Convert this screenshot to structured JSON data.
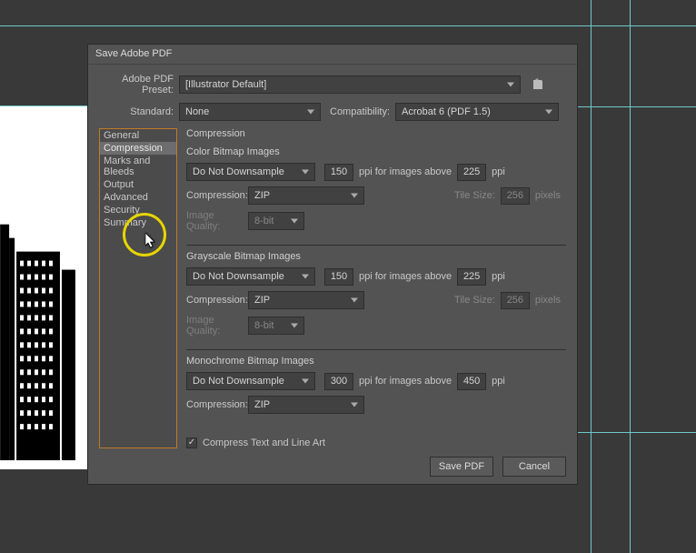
{
  "canvas": {
    "artwork_desc": "building-illustration"
  },
  "dialog": {
    "title": "Save Adobe PDF",
    "preset_label": "Adobe PDF Preset:",
    "preset_value": "[Illustrator Default]",
    "standard_label": "Standard:",
    "standard_value": "None",
    "compat_label": "Compatibility:",
    "compat_value": "Acrobat 6 (PDF 1.5)"
  },
  "sidebar": {
    "items": [
      "General",
      "Compression",
      "Marks and Bleeds",
      "Output",
      "Advanced",
      "Security",
      "Summary"
    ],
    "selected_index": 1
  },
  "panel": {
    "title": "Compression",
    "color": {
      "title": "Color Bitmap Images",
      "downsample": "Do Not Downsample",
      "ppi": "150",
      "above_label": "ppi for images above",
      "above_ppi": "225",
      "ppi_unit": "ppi",
      "compress_label": "Compression:",
      "compress_value": "ZIP",
      "tile_label": "Tile Size:",
      "tile_value": "256",
      "tile_unit": "pixels",
      "quality_label": "Image Quality:",
      "quality_value": "8-bit"
    },
    "gray": {
      "title": "Grayscale Bitmap Images",
      "downsample": "Do Not Downsample",
      "ppi": "150",
      "above_label": "ppi for images above",
      "above_ppi": "225",
      "ppi_unit": "ppi",
      "compress_label": "Compression:",
      "compress_value": "ZIP",
      "tile_label": "Tile Size:",
      "tile_value": "256",
      "tile_unit": "pixels",
      "quality_label": "Image Quality:",
      "quality_value": "8-bit"
    },
    "mono": {
      "title": "Monochrome Bitmap Images",
      "downsample": "Do Not Downsample",
      "ppi": "300",
      "above_label": "ppi for images above",
      "above_ppi": "450",
      "ppi_unit": "ppi",
      "compress_label": "Compression:",
      "compress_value": "ZIP"
    },
    "compress_text_label": "Compress Text and Line Art",
    "compress_text_checked": true
  },
  "footer": {
    "save": "Save PDF",
    "cancel": "Cancel"
  }
}
